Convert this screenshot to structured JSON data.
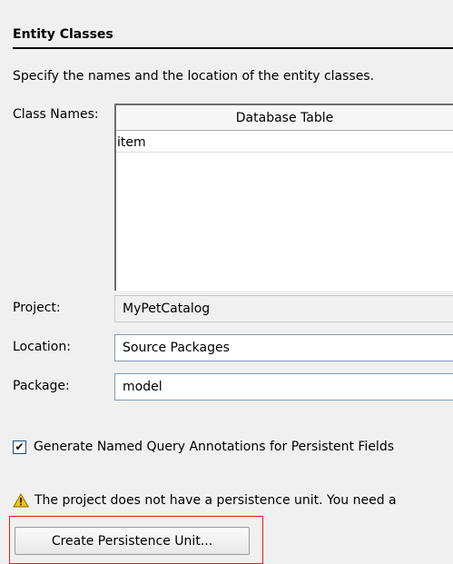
{
  "section": {
    "title": "Entity Classes",
    "description": "Specify the names and the location of the entity classes."
  },
  "class_names": {
    "label": "Class Names:",
    "column_header": "Database Table",
    "rows": [
      "item"
    ]
  },
  "project": {
    "label": "Project:",
    "value": "MyPetCatalog"
  },
  "location": {
    "label": "Location:",
    "value": "Source Packages"
  },
  "package": {
    "label": "Package:",
    "value": "model"
  },
  "generate_queries": {
    "label": "Generate Named Query Annotations for Persistent Fields",
    "checked": true
  },
  "warning": {
    "icon": "warning-icon",
    "text": "The project does not have a persistence unit. You need a"
  },
  "create_button": {
    "label": "Create Persistence Unit..."
  },
  "colors": {
    "highlight": "#e02020",
    "warning": "#f5c400"
  }
}
